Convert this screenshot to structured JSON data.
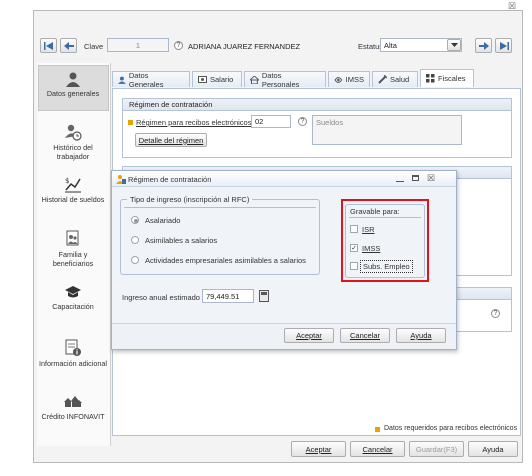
{
  "close_glyph": "☒",
  "header": {
    "clave_label": "Clave",
    "clave_value": "1",
    "employee_name": "ADRIANA JUAREZ FERNANDEZ",
    "estatus_label": "Estatus",
    "estatus_value": "Alta"
  },
  "sidebar": {
    "items": [
      {
        "label": "Datos generales",
        "icon": "person-icon"
      },
      {
        "label": "Histórico del trabajador",
        "icon": "person-history-icon"
      },
      {
        "label": "Historial de sueldos",
        "icon": "salary-chart-icon"
      },
      {
        "label": "Familia y beneficiarios",
        "icon": "family-icon"
      },
      {
        "label": "Capacitación",
        "icon": "graduation-cap-icon"
      },
      {
        "label": "Información adicional",
        "icon": "info-document-icon"
      },
      {
        "label": "Crédito INFONAVIT",
        "icon": "houses-icon"
      }
    ]
  },
  "tabs": [
    "Datos Generales",
    "Salario",
    "Datos Personales",
    "IMSS",
    "Salud",
    "Fiscales"
  ],
  "regimen_group": {
    "title": "Régimen de contratación",
    "field_label": "Régimen para recibos electrónicos",
    "field_value": "02",
    "description": "Sueldos",
    "detail_button": "Detalle del régimen"
  },
  "legend": "Datos requeridos para recibos electrónicos",
  "main_buttons": {
    "aceptar": "Aceptar",
    "cancelar": "Cancelar",
    "guardar": "Guardar(F3)",
    "ayuda": "Ayuda"
  },
  "dialog": {
    "title": "Régimen de contratación",
    "tipo_group_title": "Tipo de ingreso (inscripción al RFC)",
    "radios": [
      "Asalariado",
      "Asimilables a salarios",
      "Actividades empresariales asimilables a salarios"
    ],
    "selected_radio": "Asalariado",
    "gravable_title": "Gravable para:",
    "checks": [
      {
        "label": "ISR",
        "checked": false
      },
      {
        "label": "IMSS",
        "checked": true
      },
      {
        "label": "Subs. Empleo",
        "checked": false
      }
    ],
    "ingreso_label": "Ingreso anual estimado",
    "ingreso_value": "79,449.51",
    "buttons": {
      "aceptar": "Aceptar",
      "cancelar": "Cancelar",
      "ayuda": "Ayuda"
    }
  },
  "colors": {
    "highlight_red": "#e2121b",
    "required_marker": "#f0a000",
    "accent_blue": "#3a6ea5"
  }
}
